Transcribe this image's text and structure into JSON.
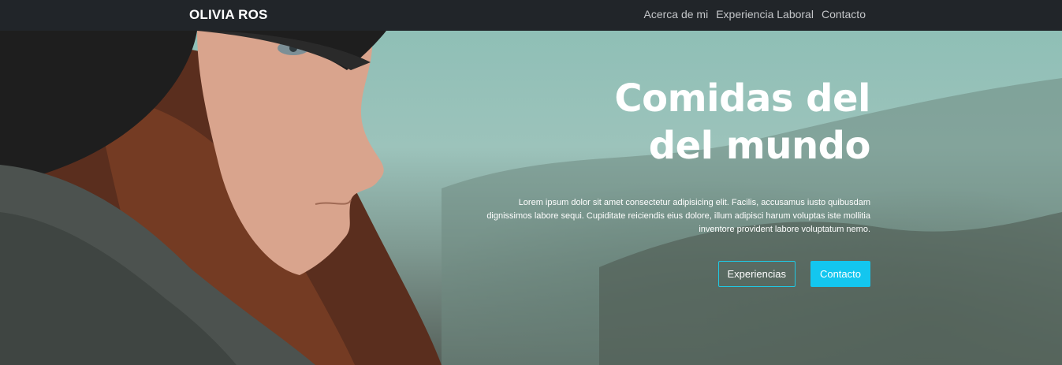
{
  "navbar": {
    "brand": "OLIVIA ROS",
    "links": [
      "Acerca de mi",
      "Experiencia Laboral",
      "Contacto"
    ]
  },
  "hero": {
    "title_line1": "Comidas del",
    "title_line2": "del mundo",
    "description": "Lorem ipsum dolor sit amet consectetur adipisicing elit. Facilis, accusamus iusto quibusdam dignissimos labore sequi. Cupiditate reiciendis eius dolore, illum adipisci harum voluptas iste mollitia inventore provident labore voluptatum nemo.",
    "buttons": {
      "primary_outline": "Experiencias",
      "primary_solid": "Contacto"
    }
  },
  "colors": {
    "navbar_bg": "#212529",
    "accent": "#13c6ef"
  }
}
